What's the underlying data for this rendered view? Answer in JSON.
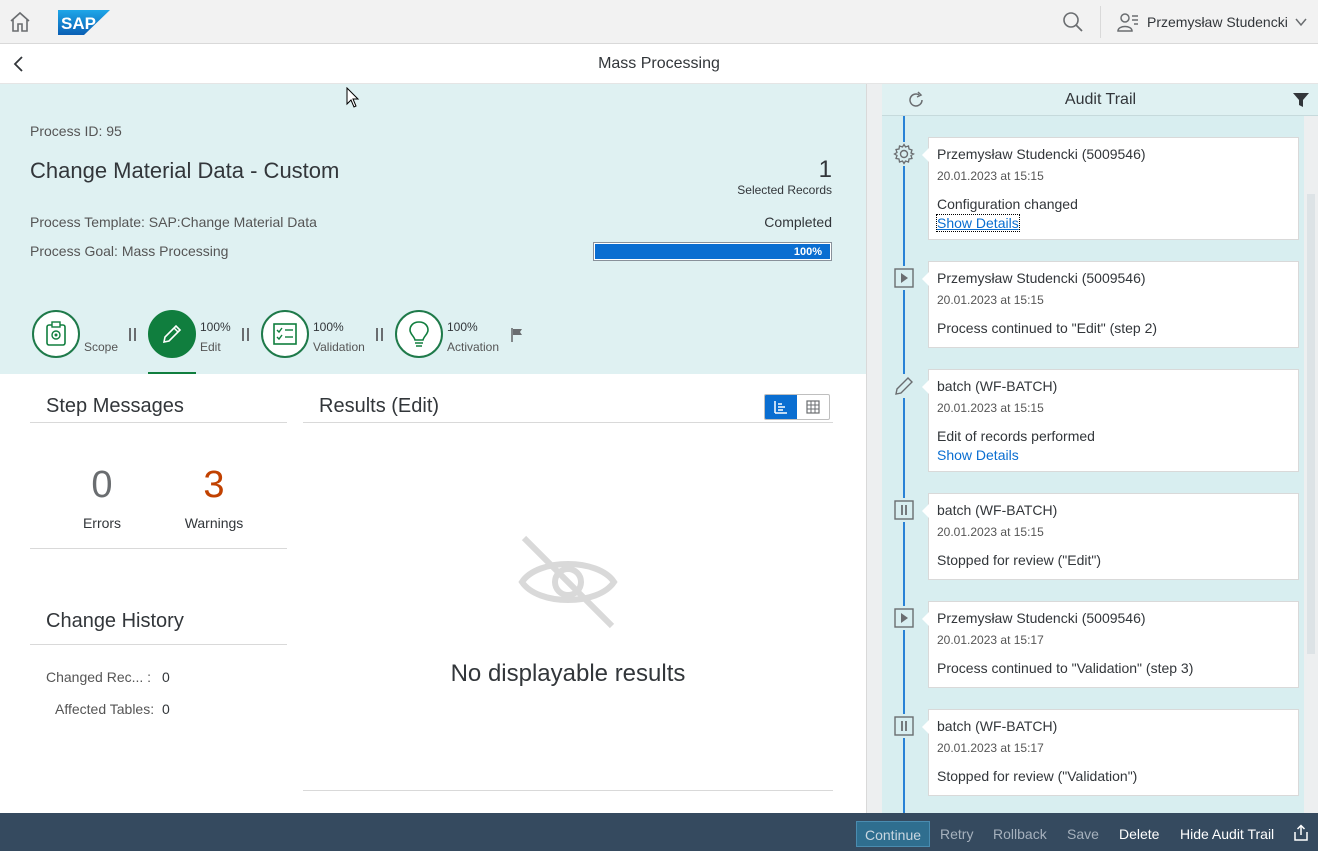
{
  "shell": {
    "logo_text": "SAP",
    "user_name": "Przemysław Studencki"
  },
  "page": {
    "title": "Mass Processing"
  },
  "process": {
    "id_text": "Process ID: 95",
    "title": "Change Material Data - Custom",
    "selected_count": "1",
    "selected_label": "Selected Records",
    "template_text": "Process Template: SAP:Change Material Data",
    "status": "Completed",
    "goal_text": "Process Goal: Mass Processing",
    "progress_text": "100%",
    "progress_value": 100
  },
  "flow": {
    "steps": [
      {
        "label": "Scope",
        "pct": "",
        "icon": "clipboard-icon"
      },
      {
        "label": "Edit",
        "pct": "100%",
        "icon": "pencil-icon"
      },
      {
        "label": "Validation",
        "pct": "100%",
        "icon": "checklist-icon"
      },
      {
        "label": "Activation",
        "pct": "100%",
        "icon": "lightbulb-icon"
      }
    ]
  },
  "step_messages": {
    "title": "Step Messages",
    "errors_count": "0",
    "errors_label": "Errors",
    "warnings_count": "3",
    "warnings_label": "Warnings",
    "warnings_color": "#c14100"
  },
  "change_history": {
    "title": "Change History",
    "changed_label": "Changed Rec... :",
    "changed_value": "0",
    "tables_label": "Affected Tables:",
    "tables_value": "0"
  },
  "results": {
    "title": "Results (Edit)",
    "empty_text": "No displayable results"
  },
  "audit": {
    "title": "Audit Trail",
    "events": [
      {
        "icon": "gear-icon",
        "who": "Przemysław Studencki (5009546)",
        "when": "20.01.2023 at 15:15",
        "what": "Configuration changed",
        "details": "Show Details"
      },
      {
        "icon": "play-icon",
        "who": "Przemysław Studencki (5009546)",
        "when": "20.01.2023 at 15:15",
        "what": "Process continued to \"Edit\" (step 2)"
      },
      {
        "icon": "pencil-icon",
        "who": "batch (WF-BATCH)",
        "when": "20.01.2023 at 15:15",
        "what": "Edit of records performed",
        "details": "Show Details"
      },
      {
        "icon": "pause-icon",
        "who": "batch (WF-BATCH)",
        "when": "20.01.2023 at 15:15",
        "what": "Stopped for review (\"Edit\")"
      },
      {
        "icon": "play-icon",
        "who": "Przemysław Studencki (5009546)",
        "when": "20.01.2023 at 15:17",
        "what": "Process continued to \"Validation\" (step 3)"
      },
      {
        "icon": "pause-icon",
        "who": "batch (WF-BATCH)",
        "when": "20.01.2023 at 15:17",
        "what": "Stopped for review (\"Validation\")"
      }
    ]
  },
  "footer": {
    "continue": "Continue",
    "retry": "Retry",
    "rollback": "Rollback",
    "save": "Save",
    "delete": "Delete",
    "hide_audit": "Hide Audit Trail"
  },
  "colors": {
    "accent": "#0a6ed1",
    "positive": "#107e3e",
    "header_bg": "#dff1f2",
    "footer_bg": "#354a5f"
  }
}
